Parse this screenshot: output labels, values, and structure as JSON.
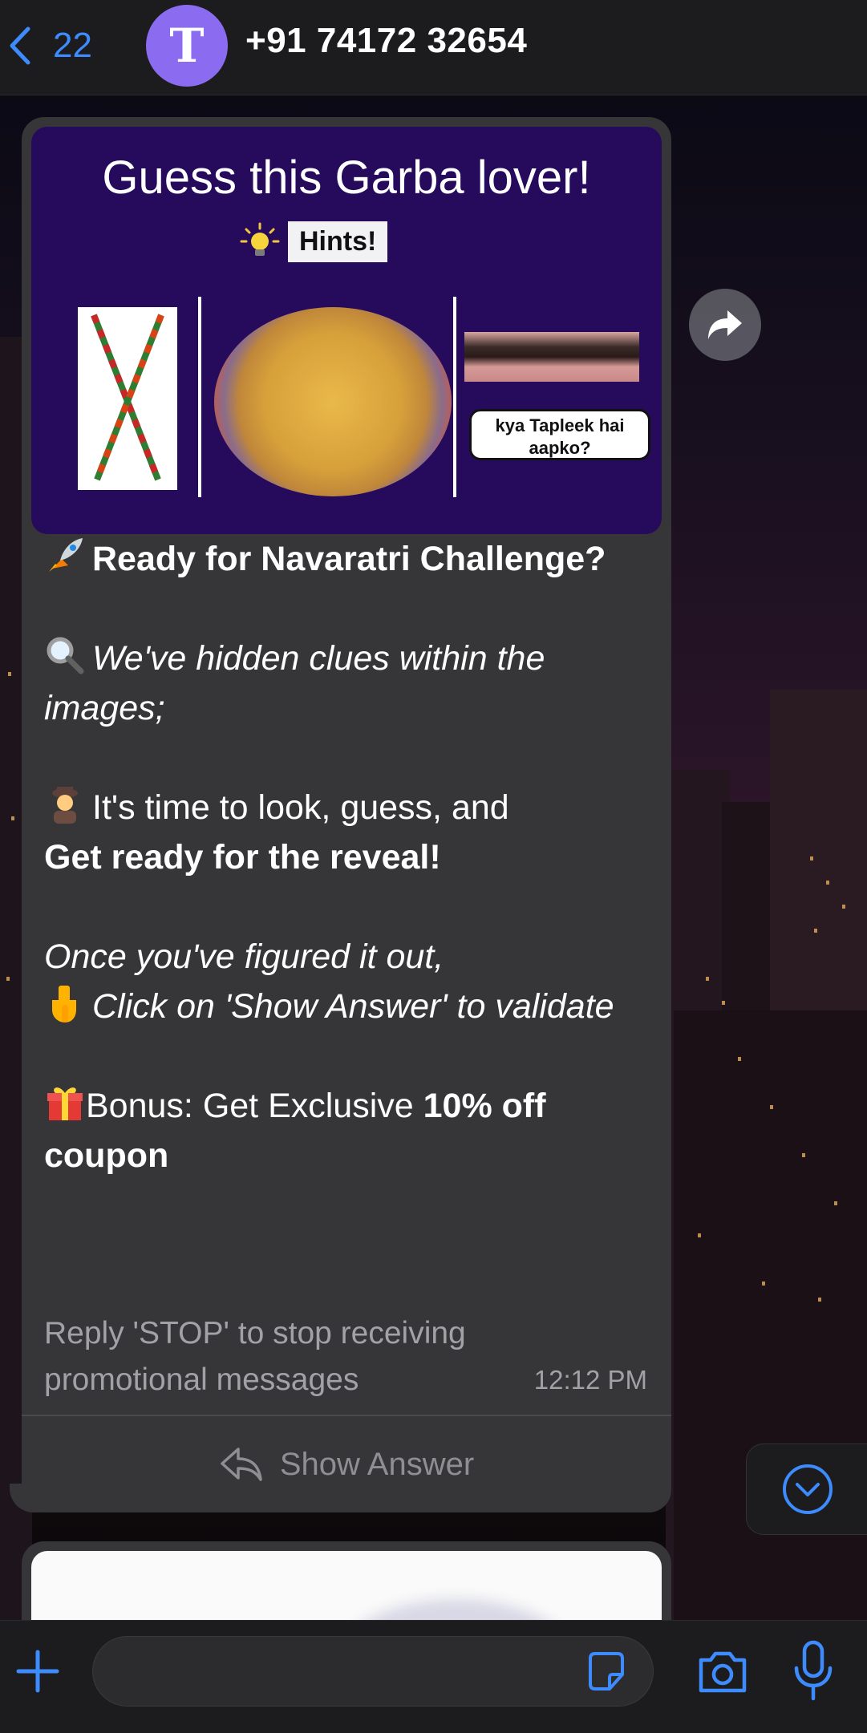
{
  "header": {
    "back_count": "22",
    "avatar_letter": "T",
    "contact": "+91 74172 32654"
  },
  "media": {
    "title": "Guess this Garba lover!",
    "hints_label": "Hints!",
    "speech_text": "kya Tapleek hai aapko?"
  },
  "message": {
    "line1": "Ready for Navaratri Challenge?",
    "line2": "We've hidden clues within the images;",
    "line3a": "It's time to look, guess, and",
    "line3b": "Get ready for the reveal!",
    "line4a": "Once you've figured it out,",
    "line4b": "Click on 'Show Answer' to validate",
    "line5a": "Bonus: Get Exclusive ",
    "line5b": "10% off coupon",
    "footer": "Reply 'STOP' to stop receiving promotional messages",
    "time": "12:12 PM"
  },
  "actions": {
    "show_answer": "Show Answer"
  },
  "icons": {
    "back": "chevron-left-icon",
    "forward": "forward-arrow-icon",
    "scroll": "chevron-down-circle-icon",
    "plus": "plus-icon",
    "sticker": "sticker-icon",
    "camera": "camera-icon",
    "mic": "microphone-icon",
    "reply": "reply-arrow-icon"
  },
  "colors": {
    "accent": "#3d8bfd",
    "bubble": "#363638",
    "header": "#1c1c1e",
    "avatar": "#8b6cf0",
    "media_bg": "#260b5c"
  }
}
